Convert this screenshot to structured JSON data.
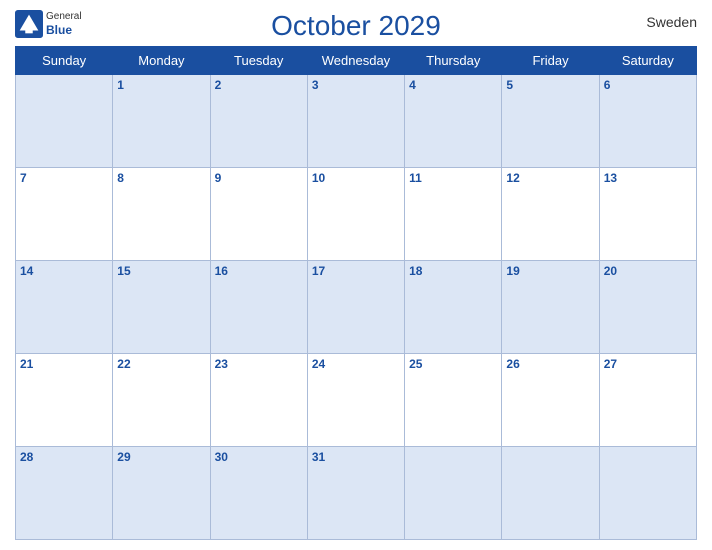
{
  "header": {
    "title": "October 2029",
    "country": "Sweden",
    "logo_general": "General",
    "logo_blue": "Blue"
  },
  "days_of_week": [
    "Sunday",
    "Monday",
    "Tuesday",
    "Wednesday",
    "Thursday",
    "Friday",
    "Saturday"
  ],
  "weeks": [
    [
      "",
      "1",
      "2",
      "3",
      "4",
      "5",
      "6"
    ],
    [
      "7",
      "8",
      "9",
      "10",
      "11",
      "12",
      "13"
    ],
    [
      "14",
      "15",
      "16",
      "17",
      "18",
      "19",
      "20"
    ],
    [
      "21",
      "22",
      "23",
      "24",
      "25",
      "26",
      "27"
    ],
    [
      "28",
      "29",
      "30",
      "31",
      "",
      "",
      ""
    ]
  ]
}
